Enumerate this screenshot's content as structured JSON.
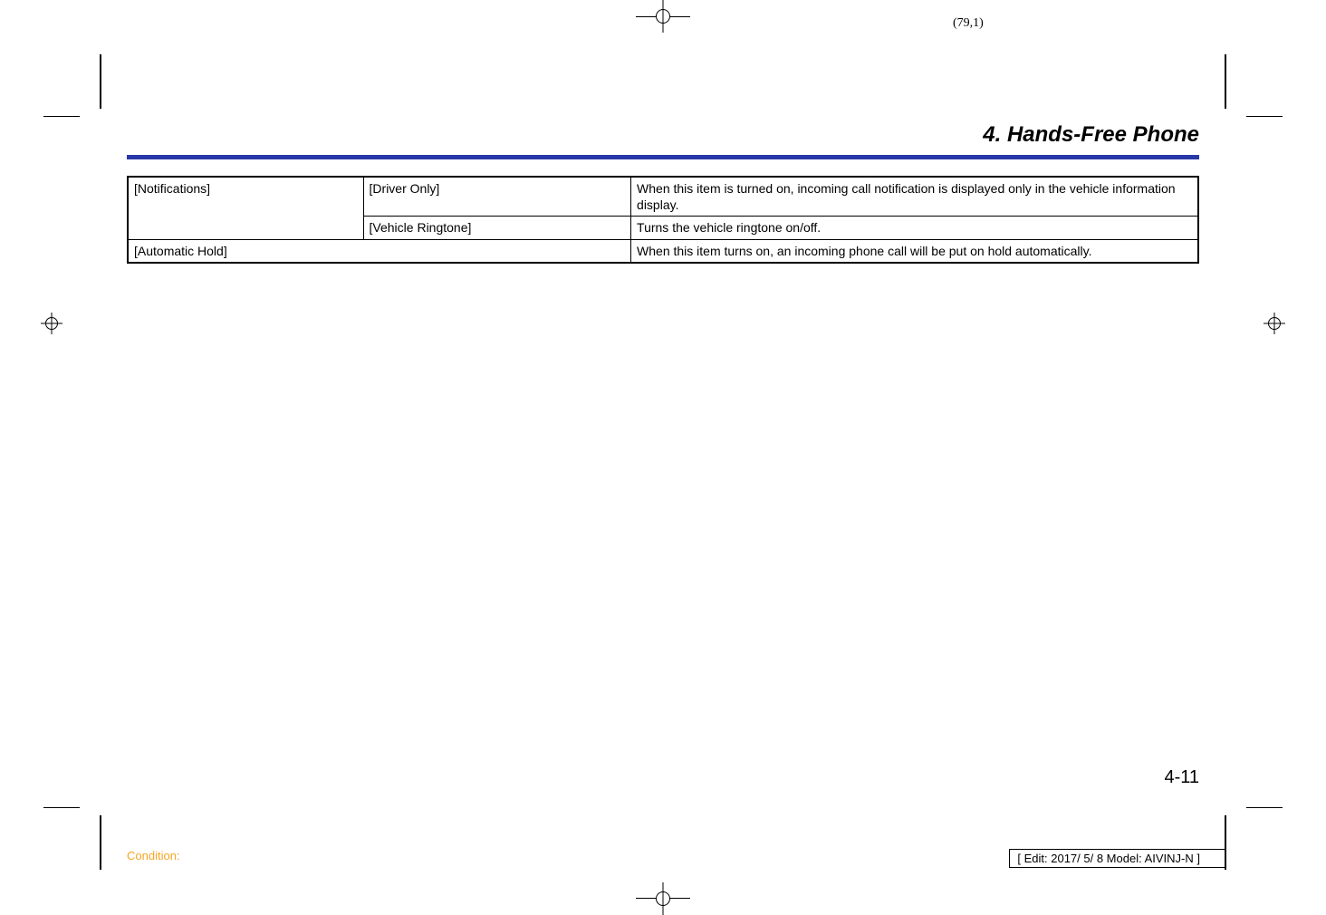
{
  "header": {
    "coord": "(79,1)",
    "section_title": "4. Hands-Free Phone"
  },
  "table": {
    "rows": [
      {
        "c1": "[Notifications]",
        "c2": "[Driver Only]",
        "c3": "When this item is turned on, incoming call notification is displayed only in the vehicle information display."
      },
      {
        "c2": "[Vehicle Ringtone]",
        "c3": "Turns the vehicle ringtone on/off."
      },
      {
        "c1": "[Automatic Hold]",
        "c3": "When this item turns on, an incoming phone call will be put on hold automatically."
      }
    ]
  },
  "footer": {
    "page_number": "4-11",
    "condition_label": "Condition:",
    "edit_info": "[ Edit: 2017/ 5/ 8   Model: AIVINJ-N ]"
  }
}
